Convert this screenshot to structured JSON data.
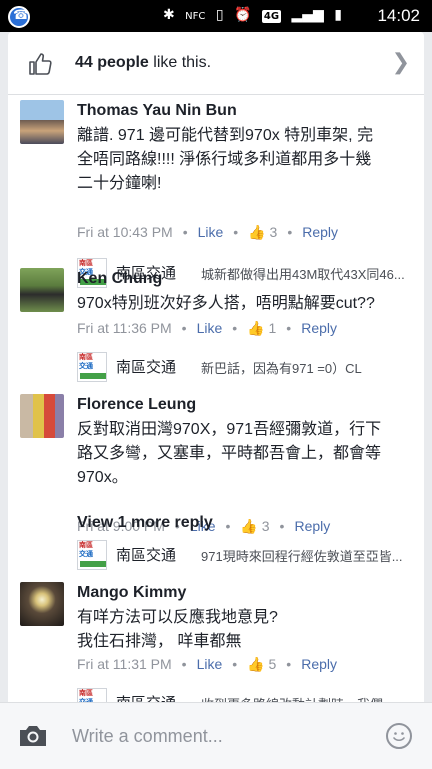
{
  "status_bar": {
    "time": "14:02",
    "network": "4G",
    "nfc": "NFC"
  },
  "likes": {
    "count_text": "44 people",
    "suffix": " like this."
  },
  "comments": [
    {
      "author": "Thomas Yau Nin Bun",
      "lines": [
        "離譜. 971 邊可能代替到970x 特別車架, 完",
        "全唔同路線!!!! 淨係行域多利道都用多十幾",
        "二十分鐘喇!"
      ],
      "time": "Fri at 10:43 PM",
      "like_label": "Like",
      "reaction_count": "3",
      "reply_label": "Reply",
      "reply": {
        "name": "南區交通",
        "text": "城新都做得出用43M取代43X同46..."
      }
    },
    {
      "author": "Ken Chung",
      "lines": [
        "970x特別班次好多人搭，唔明點解要cut??"
      ],
      "time": "Fri at 11:36 PM",
      "like_label": "Like",
      "reaction_count": "1",
      "reply_label": "Reply",
      "reply": {
        "name": "南區交通",
        "text": "新巴話，因為有971 =0）CL"
      }
    },
    {
      "author": "Florence Leung",
      "lines": [
        "反對取消田灣970X，971吾經彌敦道，行下",
        "路又多彎，又塞車，平時都吾會上，都會等",
        "970x。"
      ],
      "time": "Fri at 9:00 PM",
      "like_label": "Like",
      "reaction_count": "3",
      "reply_label": "Reply",
      "view_more": "View 1 more reply",
      "reply": {
        "name": "南區交通",
        "text": "971現時來回程行經佐敦道至亞皆..."
      }
    },
    {
      "author": "Mango Kimmy",
      "lines": [
        "有咩方法可以反應我地意見?",
        "我住石排灣， 咩車都無"
      ],
      "time": "Fri at 11:31 PM",
      "like_label": "Like",
      "reaction_count": "5",
      "reply_label": "Reply",
      "reply": {
        "name": "南區交通",
        "text": "收到更多路線改動計劃時，我們..."
      }
    }
  ],
  "reply_avatar": {
    "top": "南區",
    "bottom": "交通"
  },
  "composer": {
    "placeholder": "Write a comment..."
  },
  "colors": {
    "link": "#4b6dab",
    "meta": "#90949c",
    "text": "#1d2129"
  }
}
